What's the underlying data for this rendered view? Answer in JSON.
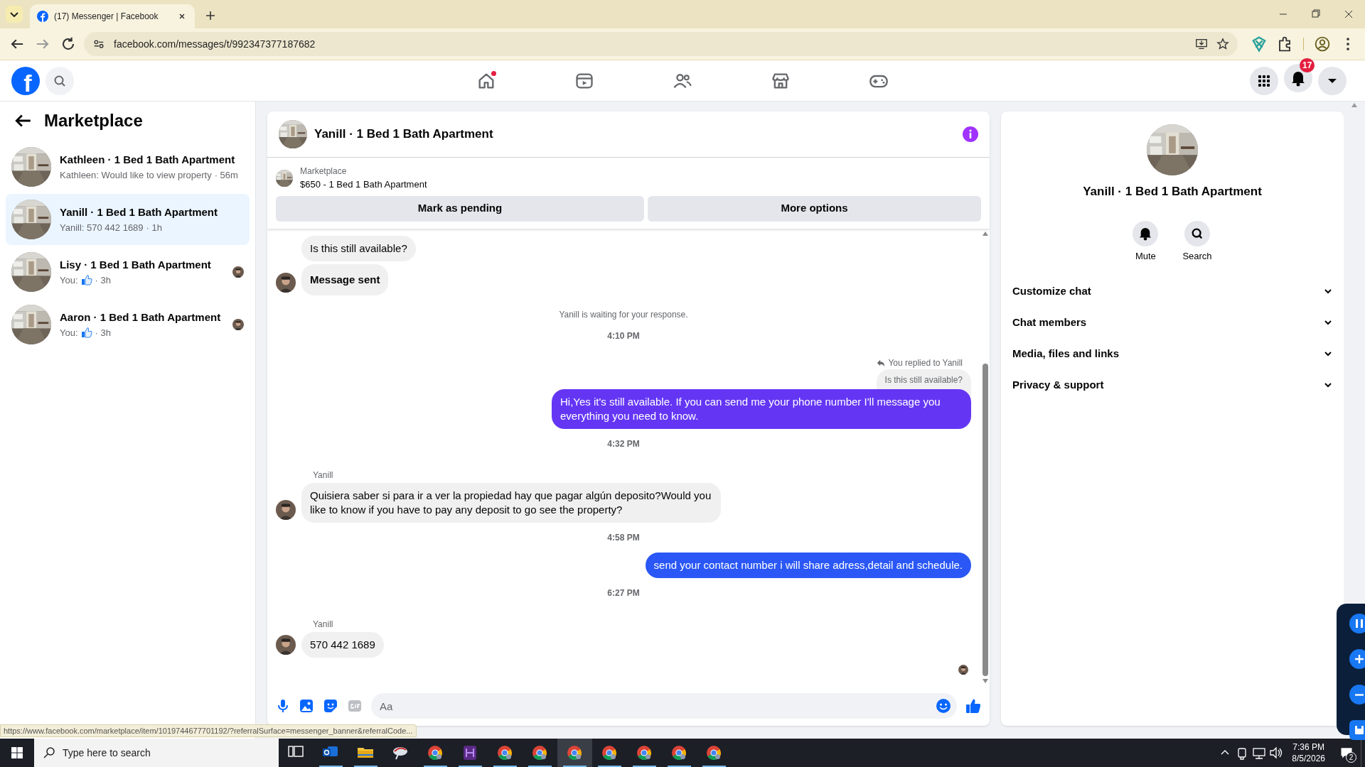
{
  "browser": {
    "tab_title": "(17) Messenger | Facebook",
    "url": "facebook.com/messages/t/992347377187682"
  },
  "header": {
    "logo": "f",
    "nav": [
      {
        "kind": "home",
        "dot": true
      },
      {
        "kind": "video",
        "dot": false
      },
      {
        "kind": "friends",
        "dot": false
      },
      {
        "kind": "marketplace",
        "dot": false
      },
      {
        "kind": "gaming",
        "dot": false
      }
    ],
    "notifications": "17"
  },
  "sidebar": {
    "title": "Marketplace",
    "items": [
      {
        "title": "Kathleen · 1 Bed 1 Bath Apartment",
        "preview": "Kathleen: Would like to view property",
        "like": false,
        "meta": "· 56m",
        "selected": false,
        "seen": false
      },
      {
        "title": "Yanill · 1 Bed 1 Bath Apartment",
        "preview": "Yanill: 570 442 1689",
        "like": false,
        "meta": "· 1h",
        "selected": true,
        "seen": false
      },
      {
        "title": "Lisy · 1 Bed 1 Bath Apartment",
        "preview": "You:",
        "like": true,
        "meta": "· 3h",
        "selected": false,
        "seen": true
      },
      {
        "title": "Aaron · 1 Bed 1 Bath Apartment",
        "preview": "You:",
        "like": true,
        "meta": "· 3h",
        "selected": false,
        "seen": true
      }
    ]
  },
  "chat": {
    "title": "Yanill · 1 Bed 1 Bath Apartment",
    "listing": {
      "label": "Marketplace",
      "name": "$650 - 1 Bed 1 Bath Apartment"
    },
    "buttons": [
      "Mark as pending",
      "More options"
    ],
    "messages": [
      {
        "kind": "incoming",
        "bubbles": [
          {
            "text": "Is this still available?",
            "bold": false
          },
          {
            "text": "Message sent",
            "bold": true
          }
        ]
      },
      {
        "kind": "system",
        "text": "Yanill is waiting for your response."
      },
      {
        "kind": "time",
        "text": "4:10 PM"
      },
      {
        "kind": "reply",
        "note": "You replied to Yanill",
        "quote": "Is this still available?"
      },
      {
        "kind": "outgoing",
        "text": "Hi,Yes it's still available. If you can send me your phone number I'll message you everything you need to know.",
        "color": "#6436f4"
      },
      {
        "kind": "time",
        "text": "4:32 PM"
      },
      {
        "kind": "incoming",
        "sender": "Yanill",
        "bubbles": [
          {
            "text": "Quisiera saber si para ir a ver la propiedad hay que pagar algún deposito?Would you like to know if you have to pay any deposit to go see the property?",
            "bold": false
          }
        ]
      },
      {
        "kind": "time",
        "text": "4:58 PM"
      },
      {
        "kind": "outgoing",
        "text": "send your contact number i will share adress,detail and schedule.",
        "color": "#2a57f5"
      },
      {
        "kind": "time",
        "text": "6:27 PM"
      },
      {
        "kind": "incoming",
        "sender": "Yanill",
        "bubbles": [
          {
            "text": "570 442 1689",
            "bold": false
          }
        ]
      }
    ],
    "seen": true,
    "composer": {
      "placeholder": "Aa"
    }
  },
  "details": {
    "title": "Yanill · 1 Bed 1 Bath Apartment",
    "actions": [
      {
        "kind": "bell",
        "label": "Mute"
      },
      {
        "kind": "search",
        "label": "Search"
      }
    ],
    "sections": [
      {
        "label": "Customize chat",
        "expanded": false
      },
      {
        "label": "Chat members",
        "expanded": false
      },
      {
        "label": "Media, files and links",
        "expanded": false
      },
      {
        "label": "Privacy & support",
        "expanded": false
      }
    ]
  },
  "status_url": "https://www.facebook.com/marketplace/item/1019744677701192/?referralSurface=messenger_banner&referralCode...",
  "taskbar": {
    "search_placeholder": "Type here to search",
    "apps": [
      {
        "kind": "taskview",
        "open": false,
        "selected": false
      },
      {
        "kind": "mail",
        "open": true,
        "selected": false
      },
      {
        "kind": "folder",
        "open": true,
        "selected": false
      },
      {
        "kind": "app",
        "open": false,
        "selected": false
      },
      {
        "kind": "chrome",
        "open": true,
        "selected": false
      },
      {
        "kind": "purple",
        "open": true,
        "selected": false
      },
      {
        "kind": "chrome",
        "open": true,
        "selected": false
      },
      {
        "kind": "chrome",
        "open": true,
        "selected": false
      },
      {
        "kind": "chrome",
        "open": true,
        "selected": true
      },
      {
        "kind": "chrome",
        "open": true,
        "selected": false
      },
      {
        "kind": "chrome",
        "open": true,
        "selected": false
      },
      {
        "kind": "chrome",
        "open": true,
        "selected": false
      },
      {
        "kind": "chrome",
        "open": true,
        "selected": false
      }
    ],
    "time": "7:36 PM",
    "date": "8/5/2026",
    "notifications": "2"
  }
}
